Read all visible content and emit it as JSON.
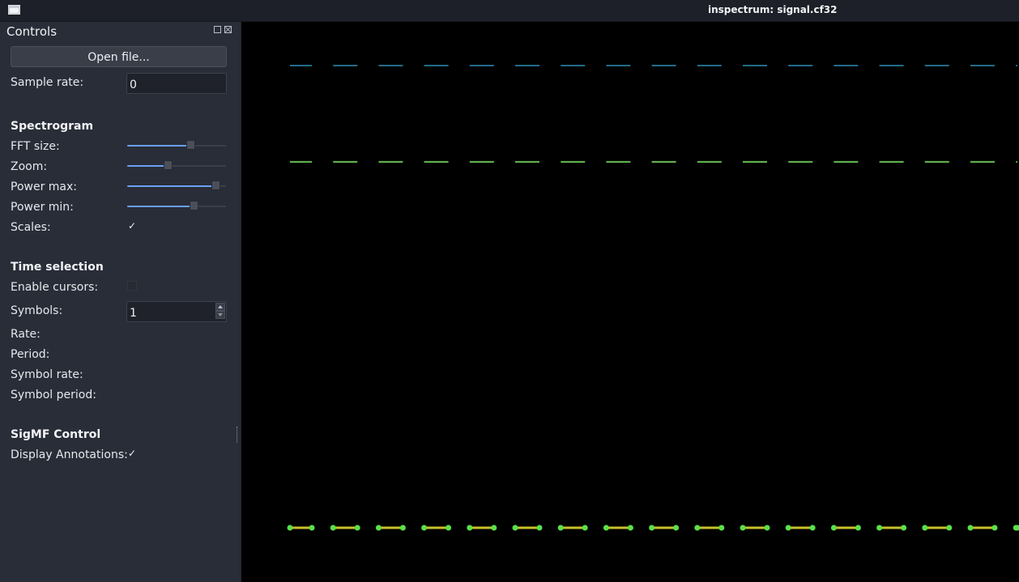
{
  "window": {
    "title": "inspectrum: signal.cf32"
  },
  "icons": {
    "app": "app-window-icon",
    "float": "dock-float-icon",
    "close": "dock-close-icon",
    "spin_up": "spin-up-arrow-icon",
    "spin_down": "spin-down-arrow-icon"
  },
  "controls": {
    "title": "Controls",
    "open_file_label": "Open file...",
    "sample_rate": {
      "label": "Sample rate:",
      "value": "0"
    },
    "spectrogram": {
      "heading": "Spectrogram",
      "fft_size": {
        "label": "FFT size:",
        "level": 0.64
      },
      "zoom": {
        "label": "Zoom:",
        "level": 0.41
      },
      "power_max": {
        "label": "Power max:",
        "level": 0.89
      },
      "power_min": {
        "label": "Power min:",
        "level": 0.67
      },
      "scales": {
        "label": "Scales:",
        "checked": true,
        "mark": "✓"
      }
    },
    "time_selection": {
      "heading": "Time selection",
      "enable_cursors": {
        "label": "Enable cursors:",
        "checked": false
      },
      "symbols": {
        "label": "Symbols:",
        "value": "1"
      },
      "rate": {
        "label": "Rate:"
      },
      "period": {
        "label": "Period:"
      },
      "symbol_rate": {
        "label": "Symbol rate:"
      },
      "symbol_period": {
        "label": "Symbol period:"
      }
    },
    "sigmf": {
      "heading": "SigMF Control",
      "display_annotations": {
        "label": "Display Annotations:",
        "checked": true,
        "mark": "✓"
      }
    }
  },
  "colors": {
    "slider_fill": "#6a9ff5",
    "band_top": "#2f8fb5",
    "band_mid": "#5fae4c",
    "band_bottom": "#c9c12a",
    "band_bottom_edge": "#5be04a"
  }
}
